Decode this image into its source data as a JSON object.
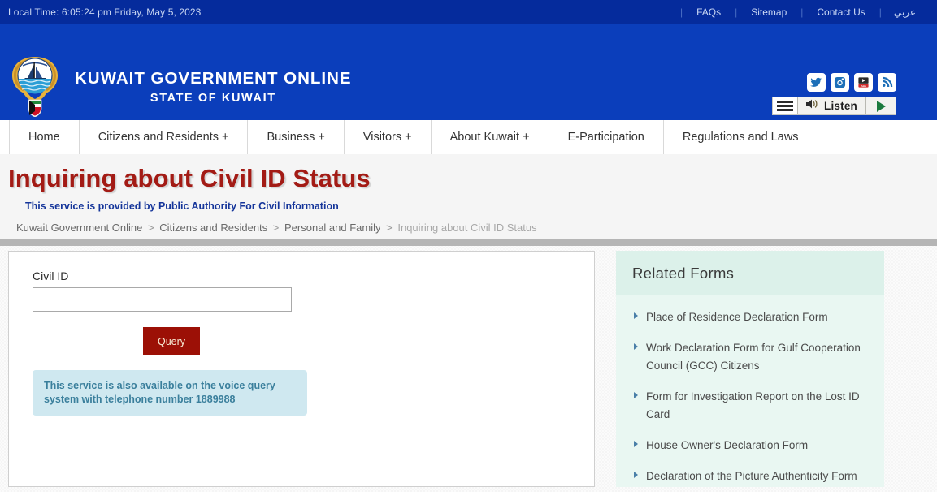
{
  "topbar": {
    "local_time": "Local Time: 6:05:24 pm Friday, May 5, 2023",
    "links": [
      {
        "label": "FAQs"
      },
      {
        "label": "Sitemap"
      },
      {
        "label": "Contact Us"
      },
      {
        "label": "عربي"
      }
    ]
  },
  "header": {
    "brand_title": "KUWAIT GOVERNMENT ONLINE",
    "brand_subtitle": "STATE OF KUWAIT",
    "emblem_icon": "kuwait-emblem-icon",
    "social": [
      {
        "icon": "twitter-icon"
      },
      {
        "icon": "instagram-icon"
      },
      {
        "icon": "youtube-icon"
      },
      {
        "icon": "rss-icon"
      }
    ],
    "listen": {
      "label": "Listen",
      "speaker_icon": "speaker-icon",
      "play_icon": "play-triangle-icon",
      "menu_icon": "settings-lines-icon"
    }
  },
  "nav": {
    "items": [
      {
        "label": "Home"
      },
      {
        "label": "Citizens and Residents +"
      },
      {
        "label": "Business +"
      },
      {
        "label": "Visitors +"
      },
      {
        "label": "About Kuwait +"
      },
      {
        "label": "E-Participation"
      },
      {
        "label": "Regulations and Laws"
      }
    ]
  },
  "page": {
    "title": "Inquiring about Civil ID Status",
    "service_provider": "This service is provided by Public Authority For Civil Information",
    "breadcrumb": {
      "items": [
        {
          "label": "Kuwait Government Online"
        },
        {
          "label": "Citizens and Residents"
        },
        {
          "label": "Personal and Family"
        }
      ],
      "separator": ">",
      "current": "Inquiring about Civil ID Status"
    }
  },
  "form": {
    "civil_id_label": "Civil ID",
    "civil_id_value": "",
    "civil_id_placeholder": "",
    "query_button": "Query",
    "voice_note": "This service is also available on the voice query system with\ntelephone number 1889988"
  },
  "related_forms": {
    "heading": "Related Forms",
    "items": [
      {
        "label": "Place of Residence Declaration Form"
      },
      {
        "label": "Work Declaration Form for Gulf Cooperation Council (GCC) Citizens"
      },
      {
        "label": "Form for Investigation Report on the Lost ID Card"
      },
      {
        "label": "House Owner's Declaration Form"
      },
      {
        "label": "Declaration of the Picture Authenticity Form"
      }
    ]
  },
  "colors": {
    "topbar_blue": "#052B9C",
    "header_blue": "#0B3EBB",
    "title_red": "#A31B15",
    "button_red": "#9C1006",
    "provider_blue": "#15359A",
    "note_bg": "#cfe8f0",
    "note_text": "#3a7f9c",
    "related_bg": "#e9f7f2",
    "related_head_bg": "#dcf1ea"
  }
}
